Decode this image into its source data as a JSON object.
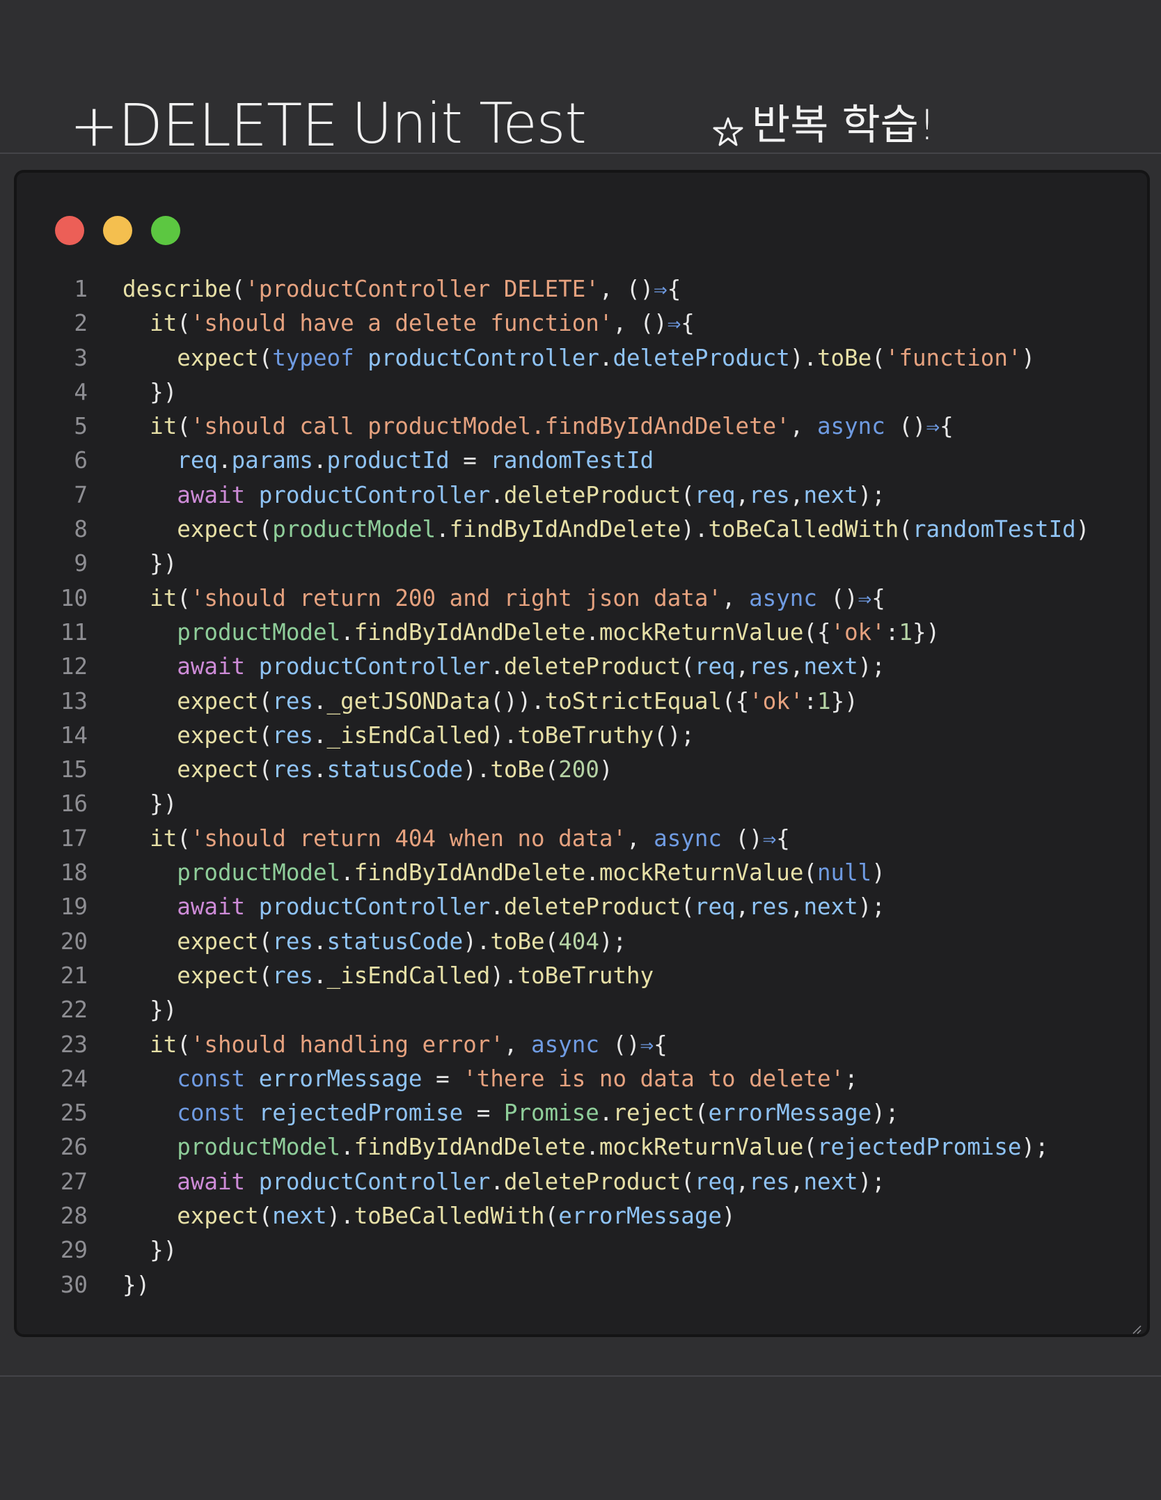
{
  "header": {
    "title_left": "+DELETE",
    "title_mid": "Unit Test",
    "note": "반복 학습!"
  },
  "window": {
    "controls": [
      "close",
      "minimize",
      "maximize"
    ],
    "colors": {
      "close": "#ec5f57",
      "minimize": "#f4bf4f",
      "maximize": "#5cc741"
    }
  },
  "code": {
    "lines": [
      [
        [
          "describe",
          "f"
        ],
        [
          "(",
          "p"
        ],
        [
          "'productController DELETE'",
          "s"
        ],
        [
          ", ",
          "p"
        ],
        [
          "()",
          "p"
        ],
        [
          "⇒",
          "ar"
        ],
        [
          "{",
          "p"
        ]
      ],
      [
        [
          "  ",
          "p"
        ],
        [
          "it",
          "f"
        ],
        [
          "(",
          "p"
        ],
        [
          "'should have a delete function'",
          "s"
        ],
        [
          ", ",
          "p"
        ],
        [
          "()",
          "p"
        ],
        [
          "⇒",
          "ar"
        ],
        [
          "{",
          "p"
        ]
      ],
      [
        [
          "    ",
          "p"
        ],
        [
          "expect",
          "f"
        ],
        [
          "(",
          "p"
        ],
        [
          "typeof",
          "k"
        ],
        [
          " ",
          "p"
        ],
        [
          "productController",
          "v"
        ],
        [
          ".",
          "p"
        ],
        [
          "deleteProduct",
          "v"
        ],
        [
          ").",
          "p"
        ],
        [
          "toBe",
          "f"
        ],
        [
          "(",
          "p"
        ],
        [
          "'function'",
          "s"
        ],
        [
          ")",
          "p"
        ]
      ],
      [
        [
          "  })",
          "p"
        ]
      ],
      [
        [
          "  ",
          "p"
        ],
        [
          "it",
          "f"
        ],
        [
          "(",
          "p"
        ],
        [
          "'should call productModel.findByIdAndDelete'",
          "s"
        ],
        [
          ", ",
          "p"
        ],
        [
          "async",
          "k"
        ],
        [
          " ()",
          "p"
        ],
        [
          "⇒",
          "ar"
        ],
        [
          "{",
          "p"
        ]
      ],
      [
        [
          "    ",
          "p"
        ],
        [
          "req",
          "v"
        ],
        [
          ".",
          "p"
        ],
        [
          "params",
          "v"
        ],
        [
          ".",
          "p"
        ],
        [
          "productId",
          "v"
        ],
        [
          " = ",
          "p"
        ],
        [
          "randomTestId",
          "v"
        ]
      ],
      [
        [
          "    ",
          "p"
        ],
        [
          "await",
          "m"
        ],
        [
          " ",
          "p"
        ],
        [
          "productController",
          "v"
        ],
        [
          ".",
          "p"
        ],
        [
          "deleteProduct",
          "f"
        ],
        [
          "(",
          "p"
        ],
        [
          "req",
          "v"
        ],
        [
          ",",
          "p"
        ],
        [
          "res",
          "v"
        ],
        [
          ",",
          "p"
        ],
        [
          "next",
          "v"
        ],
        [
          ");",
          "p"
        ]
      ],
      [
        [
          "    ",
          "p"
        ],
        [
          "expect",
          "f"
        ],
        [
          "(",
          "p"
        ],
        [
          "productModel",
          "t"
        ],
        [
          ".",
          "p"
        ],
        [
          "findByIdAndDelete",
          "f"
        ],
        [
          ").",
          "p"
        ],
        [
          "toBeCalledWith",
          "f"
        ],
        [
          "(",
          "p"
        ],
        [
          "randomTestId",
          "v"
        ],
        [
          ")",
          "p"
        ]
      ],
      [
        [
          "  })",
          "p"
        ]
      ],
      [
        [
          "  ",
          "p"
        ],
        [
          "it",
          "f"
        ],
        [
          "(",
          "p"
        ],
        [
          "'should return 200 and right json data'",
          "s"
        ],
        [
          ", ",
          "p"
        ],
        [
          "async",
          "k"
        ],
        [
          " ()",
          "p"
        ],
        [
          "⇒",
          "ar"
        ],
        [
          "{",
          "p"
        ]
      ],
      [
        [
          "    ",
          "p"
        ],
        [
          "productModel",
          "t"
        ],
        [
          ".",
          "p"
        ],
        [
          "findByIdAndDelete",
          "f"
        ],
        [
          ".",
          "p"
        ],
        [
          "mockReturnValue",
          "f"
        ],
        [
          "({",
          "p"
        ],
        [
          "'ok'",
          "s"
        ],
        [
          ":",
          "p"
        ],
        [
          "1",
          "n"
        ],
        [
          "})",
          "p"
        ]
      ],
      [
        [
          "    ",
          "p"
        ],
        [
          "await",
          "m"
        ],
        [
          " ",
          "p"
        ],
        [
          "productController",
          "v"
        ],
        [
          ".",
          "p"
        ],
        [
          "deleteProduct",
          "f"
        ],
        [
          "(",
          "p"
        ],
        [
          "req",
          "v"
        ],
        [
          ",",
          "p"
        ],
        [
          "res",
          "v"
        ],
        [
          ",",
          "p"
        ],
        [
          "next",
          "v"
        ],
        [
          ");",
          "p"
        ]
      ],
      [
        [
          "    ",
          "p"
        ],
        [
          "expect",
          "f"
        ],
        [
          "(",
          "p"
        ],
        [
          "res",
          "v"
        ],
        [
          ".",
          "p"
        ],
        [
          "_getJSONData",
          "f"
        ],
        [
          "()).",
          "p"
        ],
        [
          "toStrictEqual",
          "f"
        ],
        [
          "({",
          "p"
        ],
        [
          "'ok'",
          "s"
        ],
        [
          ":",
          "p"
        ],
        [
          "1",
          "n"
        ],
        [
          "})",
          "p"
        ]
      ],
      [
        [
          "    ",
          "p"
        ],
        [
          "expect",
          "f"
        ],
        [
          "(",
          "p"
        ],
        [
          "res",
          "v"
        ],
        [
          ".",
          "p"
        ],
        [
          "_isEndCalled",
          "f"
        ],
        [
          ").",
          "p"
        ],
        [
          "toBeTruthy",
          "f"
        ],
        [
          "();",
          "p"
        ]
      ],
      [
        [
          "    ",
          "p"
        ],
        [
          "expect",
          "f"
        ],
        [
          "(",
          "p"
        ],
        [
          "res",
          "v"
        ],
        [
          ".",
          "p"
        ],
        [
          "statusCode",
          "v"
        ],
        [
          ").",
          "p"
        ],
        [
          "toBe",
          "f"
        ],
        [
          "(",
          "p"
        ],
        [
          "200",
          "n"
        ],
        [
          ")",
          "p"
        ]
      ],
      [
        [
          "  })",
          "p"
        ]
      ],
      [
        [
          "  ",
          "p"
        ],
        [
          "it",
          "f"
        ],
        [
          "(",
          "p"
        ],
        [
          "'should return 404 when no data'",
          "s"
        ],
        [
          ", ",
          "p"
        ],
        [
          "async",
          "k"
        ],
        [
          " ()",
          "p"
        ],
        [
          "⇒",
          "ar"
        ],
        [
          "{",
          "p"
        ]
      ],
      [
        [
          "    ",
          "p"
        ],
        [
          "productModel",
          "t"
        ],
        [
          ".",
          "p"
        ],
        [
          "findByIdAndDelete",
          "f"
        ],
        [
          ".",
          "p"
        ],
        [
          "mockReturnValue",
          "f"
        ],
        [
          "(",
          "p"
        ],
        [
          "null",
          "k"
        ],
        [
          ")",
          "p"
        ]
      ],
      [
        [
          "    ",
          "p"
        ],
        [
          "await",
          "m"
        ],
        [
          " ",
          "p"
        ],
        [
          "productController",
          "v"
        ],
        [
          ".",
          "p"
        ],
        [
          "deleteProduct",
          "f"
        ],
        [
          "(",
          "p"
        ],
        [
          "req",
          "v"
        ],
        [
          ",",
          "p"
        ],
        [
          "res",
          "v"
        ],
        [
          ",",
          "p"
        ],
        [
          "next",
          "v"
        ],
        [
          ");",
          "p"
        ]
      ],
      [
        [
          "    ",
          "p"
        ],
        [
          "expect",
          "f"
        ],
        [
          "(",
          "p"
        ],
        [
          "res",
          "v"
        ],
        [
          ".",
          "p"
        ],
        [
          "statusCode",
          "v"
        ],
        [
          ").",
          "p"
        ],
        [
          "toBe",
          "f"
        ],
        [
          "(",
          "p"
        ],
        [
          "404",
          "n"
        ],
        [
          ");",
          "p"
        ]
      ],
      [
        [
          "    ",
          "p"
        ],
        [
          "expect",
          "f"
        ],
        [
          "(",
          "p"
        ],
        [
          "res",
          "v"
        ],
        [
          ".",
          "p"
        ],
        [
          "_isEndCalled",
          "f"
        ],
        [
          ").",
          "p"
        ],
        [
          "toBeTruthy",
          "f"
        ]
      ],
      [
        [
          "  })",
          "p"
        ]
      ],
      [
        [
          "  ",
          "p"
        ],
        [
          "it",
          "f"
        ],
        [
          "(",
          "p"
        ],
        [
          "'should handling error'",
          "s"
        ],
        [
          ", ",
          "p"
        ],
        [
          "async",
          "k"
        ],
        [
          " ()",
          "p"
        ],
        [
          "⇒",
          "ar"
        ],
        [
          "{",
          "p"
        ]
      ],
      [
        [
          "    ",
          "p"
        ],
        [
          "const",
          "k"
        ],
        [
          " ",
          "p"
        ],
        [
          "errorMessage",
          "v"
        ],
        [
          " = ",
          "p"
        ],
        [
          "'there is no data to delete'",
          "s"
        ],
        [
          ";",
          "p"
        ]
      ],
      [
        [
          "    ",
          "p"
        ],
        [
          "const",
          "k"
        ],
        [
          " ",
          "p"
        ],
        [
          "rejectedPromise",
          "v"
        ],
        [
          " = ",
          "p"
        ],
        [
          "Promise",
          "t"
        ],
        [
          ".",
          "p"
        ],
        [
          "reject",
          "f"
        ],
        [
          "(",
          "p"
        ],
        [
          "errorMessage",
          "v"
        ],
        [
          ");",
          "p"
        ]
      ],
      [
        [
          "    ",
          "p"
        ],
        [
          "productModel",
          "t"
        ],
        [
          ".",
          "p"
        ],
        [
          "findByIdAndDelete",
          "f"
        ],
        [
          ".",
          "p"
        ],
        [
          "mockReturnValue",
          "f"
        ],
        [
          "(",
          "p"
        ],
        [
          "rejectedPromise",
          "v"
        ],
        [
          ");",
          "p"
        ]
      ],
      [
        [
          "    ",
          "p"
        ],
        [
          "await",
          "m"
        ],
        [
          " ",
          "p"
        ],
        [
          "productController",
          "v"
        ],
        [
          ".",
          "p"
        ],
        [
          "deleteProduct",
          "f"
        ],
        [
          "(",
          "p"
        ],
        [
          "req",
          "v"
        ],
        [
          ",",
          "p"
        ],
        [
          "res",
          "v"
        ],
        [
          ",",
          "p"
        ],
        [
          "next",
          "v"
        ],
        [
          ");",
          "p"
        ]
      ],
      [
        [
          "    ",
          "p"
        ],
        [
          "expect",
          "f"
        ],
        [
          "(",
          "p"
        ],
        [
          "next",
          "v"
        ],
        [
          ").",
          "p"
        ],
        [
          "toBeCalledWith",
          "f"
        ],
        [
          "(",
          "p"
        ],
        [
          "errorMessage",
          "v"
        ],
        [
          ")",
          "p"
        ]
      ],
      [
        [
          "  })",
          "p"
        ]
      ],
      [
        [
          "})",
          "p"
        ]
      ]
    ]
  }
}
